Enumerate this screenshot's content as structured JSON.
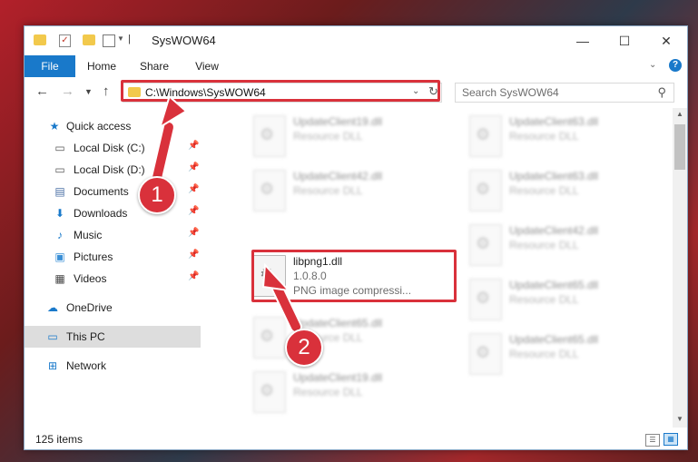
{
  "window": {
    "title": "SysWOW64",
    "min_glyph": "—",
    "max_glyph": "☐",
    "close_glyph": "✕"
  },
  "ribbon": {
    "tabs": [
      "File",
      "Home",
      "Share",
      "View"
    ],
    "help_glyph": "?"
  },
  "address": {
    "path": "C:\\Windows\\SysWOW64",
    "search_placeholder": "Search SysWOW64"
  },
  "sidebar": {
    "items": [
      {
        "label": "Quick access",
        "icon": "star-icon",
        "pinned": false
      },
      {
        "label": "Local Disk (C:)",
        "icon": "drive-icon",
        "pinned": true
      },
      {
        "label": "Local Disk (D:)",
        "icon": "drive-icon",
        "pinned": true
      },
      {
        "label": "Documents",
        "icon": "document-icon",
        "pinned": true
      },
      {
        "label": "Downloads",
        "icon": "download-icon",
        "pinned": true
      },
      {
        "label": "Music",
        "icon": "music-icon",
        "pinned": true
      },
      {
        "label": "Pictures",
        "icon": "picture-icon",
        "pinned": true
      },
      {
        "label": "Videos",
        "icon": "video-icon",
        "pinned": true
      },
      {
        "label": "OneDrive",
        "icon": "cloud-icon",
        "pinned": false
      },
      {
        "label": "This PC",
        "icon": "computer-icon",
        "pinned": false
      },
      {
        "label": "Network",
        "icon": "network-icon",
        "pinned": false
      }
    ]
  },
  "files": {
    "left": [
      {
        "name": "UpdateClient19.dll",
        "type": "Resource DLL"
      },
      {
        "name": "UpdateClient42.dll",
        "type": "Resource DLL"
      },
      {
        "name": "libpng1.dll",
        "version": "1.0.8.0",
        "type": "PNG image compressi..."
      },
      {
        "name": "UpdateClient65.dll",
        "type": "Resource DLL"
      },
      {
        "name": "UpdateClient19.dll",
        "type": "Resource DLL"
      }
    ],
    "right": [
      {
        "name": "UpdateClient63.dll",
        "type": "Resource DLL"
      },
      {
        "name": "UpdateClient63.dll",
        "type": "Resource DLL"
      },
      {
        "name": "UpdateClient42.dll",
        "type": "Resource DLL"
      },
      {
        "name": "UpdateClient65.dll",
        "type": "Resource DLL"
      },
      {
        "name": "UpdateClient65.dll",
        "type": "Resource DLL"
      }
    ]
  },
  "status": {
    "item_count": "125 items"
  },
  "annotations": {
    "step1": "1",
    "step2": "2"
  },
  "colors": {
    "accent": "#1979ca",
    "highlight": "#d9313b"
  }
}
